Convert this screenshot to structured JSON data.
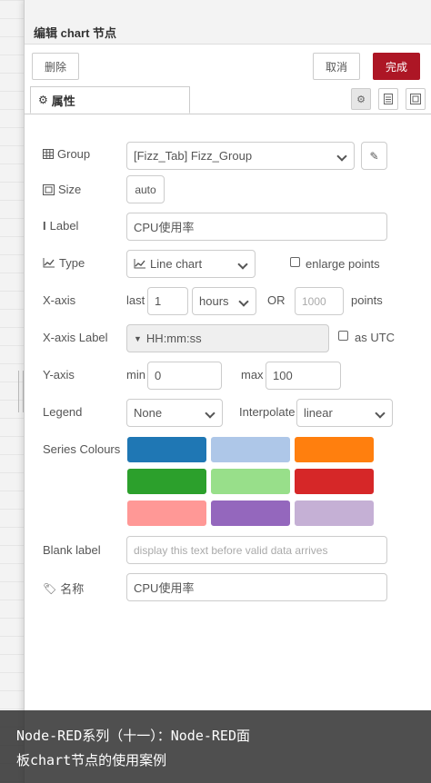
{
  "tray": {
    "title": "编辑 chart 节点",
    "delete_label": "删除",
    "cancel_label": "取消",
    "done_label": "完成",
    "tab_properties": "属性"
  },
  "form": {
    "group": {
      "label": "Group",
      "value": "[Fizz_Tab] Fizz_Group"
    },
    "size": {
      "label": "Size",
      "value": "auto"
    },
    "label": {
      "label": "Label",
      "value": "CPU使用率"
    },
    "type": {
      "label": "Type",
      "value": "Line chart",
      "enlarge_label": "enlarge points"
    },
    "xaxis": {
      "label": "X-axis",
      "last_label": "last",
      "last_value": "1",
      "unit_value": "hours",
      "or_label": "OR",
      "points_placeholder": "1000",
      "points_label": "points"
    },
    "xaxis_label": {
      "label": "X-axis Label",
      "value": "HH:mm:ss",
      "utc_label": "as UTC"
    },
    "yaxis": {
      "label": "Y-axis",
      "min_label": "min",
      "min_value": "0",
      "max_label": "max",
      "max_value": "100"
    },
    "legend": {
      "label": "Legend",
      "value": "None",
      "interpolate_label": "Interpolate",
      "interpolate_value": "linear"
    },
    "series_colours": {
      "label": "Series Colours",
      "colors": [
        "#1f77b4",
        "#aec7e8",
        "#ff7f0e",
        "#2ca02c",
        "#98df8a",
        "#d62728",
        "#ff9896",
        "#9467bd",
        "#c5b0d5"
      ]
    },
    "blank_label": {
      "label": "Blank label",
      "placeholder": "display this text before valid data arrives"
    },
    "name": {
      "label": "名称",
      "value": "CPU使用率"
    }
  },
  "overlay": {
    "line1": "Node-RED系列（十一）：Node-RED面",
    "line2": "板chart节点的使用案例"
  }
}
